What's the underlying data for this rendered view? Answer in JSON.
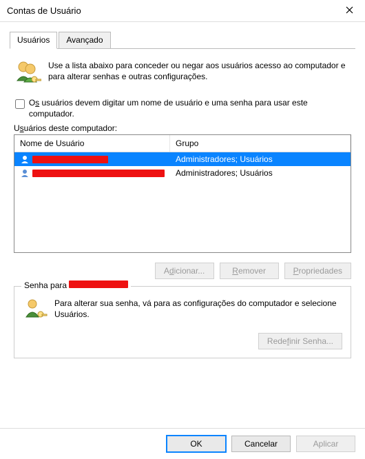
{
  "window": {
    "title": "Contas de Usuário"
  },
  "tabs": {
    "users": "Usuários",
    "advanced": "Avançado"
  },
  "intro": {
    "text": "Use a lista abaixo para conceder ou negar aos usuários acesso ao computador e para alterar senhas e outras configurações."
  },
  "checkbox": {
    "label_pre": "O",
    "label_ul": "s",
    "label_rest": " usuários devem digitar um nome de usuário e uma senha para usar este computador.",
    "checked": false
  },
  "list": {
    "caption_pre": "U",
    "caption_ul": "s",
    "caption_rest": "uários deste computador:",
    "headers": {
      "user": "Nome de Usuário",
      "group": "Grupo"
    },
    "rows": [
      {
        "redact_w": 110,
        "group": "Administradores; Usuários",
        "selected": true
      },
      {
        "redact_w": 198,
        "group": "Administradores; Usuários",
        "selected": false
      }
    ]
  },
  "buttons": {
    "add_pre": "A",
    "add_ul": "d",
    "add_rest": "icionar...",
    "remove_pre": "",
    "remove_ul": "R",
    "remove_rest": "emover",
    "props_pre": "",
    "props_ul": "P",
    "props_rest": "ropriedades"
  },
  "password_box": {
    "legend": "Senha para ",
    "legend_redact_w": 86,
    "text": "Para alterar sua senha, vá para as configurações do computador e selecione Usuários.",
    "reset_pre": "Rede",
    "reset_ul": "f",
    "reset_rest": "inir Senha..."
  },
  "footer": {
    "ok": "OK",
    "cancel": "Cancelar",
    "apply": "Aplicar"
  }
}
